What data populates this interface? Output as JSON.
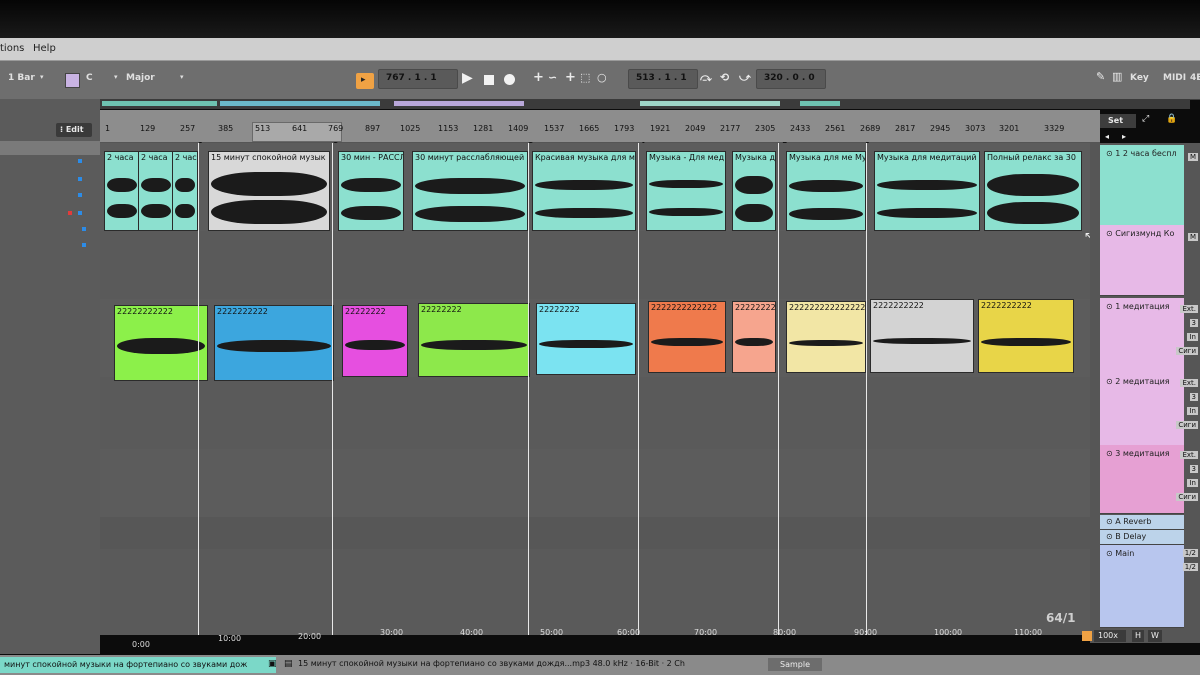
{
  "menubar": {
    "items": [
      "tions",
      "Help"
    ]
  },
  "controlbar": {
    "quantize": "1 Bar",
    "key_root": "C",
    "scale": "Major",
    "song_position": "767 .  1 .  1",
    "loop_start": "513 .  1 .  1",
    "loop_length": "320 .  0 .  0",
    "key_map": "Key",
    "midi_map": "MIDI",
    "cpu_partial": "4E"
  },
  "edit_button": "Edit",
  "ruler": {
    "ticks": [
      "1",
      "129",
      "257",
      "385",
      "513",
      "641",
      "769",
      "897",
      "1025",
      "1153",
      "1281",
      "1409",
      "1537",
      "1665",
      "1793",
      "1921",
      "2049",
      "2177",
      "2305",
      "2433",
      "2561",
      "2689",
      "2817",
      "2945",
      "3073",
      "3201",
      "3329"
    ],
    "markers": [
      "1",
      "2",
      "3",
      "4",
      "5",
      "1"
    ],
    "set_button": "Set"
  },
  "tracks": [
    {
      "name": "1 2 часа беспл",
      "color": "#8ce0cf",
      "clips": [
        "2 часа",
        "2 часа",
        "2 час",
        "15 минут спокойной музык",
        "30 мин - РАССЛ",
        "30 минут расслабляющей м",
        "Красивая музыка для ме",
        "Музыка - Для мед",
        "Музыка д",
        "Музыка для ме Му",
        "Музыка для медитаций",
        "Полный релакс за 30"
      ]
    },
    {
      "name": "Сигизмунд Ко",
      "color": "#e7b9e7",
      "clips": []
    },
    {
      "name": "1 медитация",
      "color": "#e7b9e7",
      "clips": [
        "22222222222",
        "2222222222",
        "22222222",
        "22222222",
        "22222222",
        "2222222222222",
        "22222222",
        "222222222222222",
        "2222222222",
        "2222222222"
      ]
    },
    {
      "name": "2 медитация",
      "color": "#e7b9e7",
      "clips": []
    },
    {
      "name": "3 медитация",
      "color": "#e6a0d3",
      "clips": []
    }
  ],
  "returns": [
    {
      "name": "A Reverb",
      "color": "#bcd3ea"
    },
    {
      "name": "B Delay",
      "color": "#bcd3ea"
    }
  ],
  "master": {
    "name": "Main",
    "color": "#b8c6ee",
    "out": "1/2"
  },
  "io_labels": {
    "ext": "Ext.",
    "in": "In",
    "sig": "Сиги",
    "three": "3",
    "m": "M",
    "half": "1/2"
  },
  "time_axis": [
    "0:00",
    "10:00",
    "20:00",
    "30:00",
    "40:00",
    "50:00",
    "60:00",
    "70:00",
    "80:00",
    "90:00",
    "100:00",
    "110:00"
  ],
  "zoom_hint": "64/1",
  "statusbar": {
    "tab": "минут спокойной музыки на фортепиано со звуками дож",
    "file": "15 минут спокойной музыки на фортепиано со звуками дождя...mp3  48.0 kHz · 16-Bit · 2 Ch",
    "sample": "Sample",
    "zoom": "100x",
    "h": "H",
    "w": "W"
  },
  "colors": {
    "clip_green": "#8cf04a",
    "clip_blue": "#3ca6de",
    "clip_magenta": "#e64fe0",
    "clip_lime": "#8de84b",
    "clip_cyan": "#7be3f1",
    "clip_orange": "#ef7a4c",
    "clip_salmon": "#f6a58e",
    "clip_cream": "#f2e6a5",
    "clip_gray": "#d3d3d3",
    "clip_yellow": "#e8d548",
    "accent_orange": "#f0a244"
  }
}
